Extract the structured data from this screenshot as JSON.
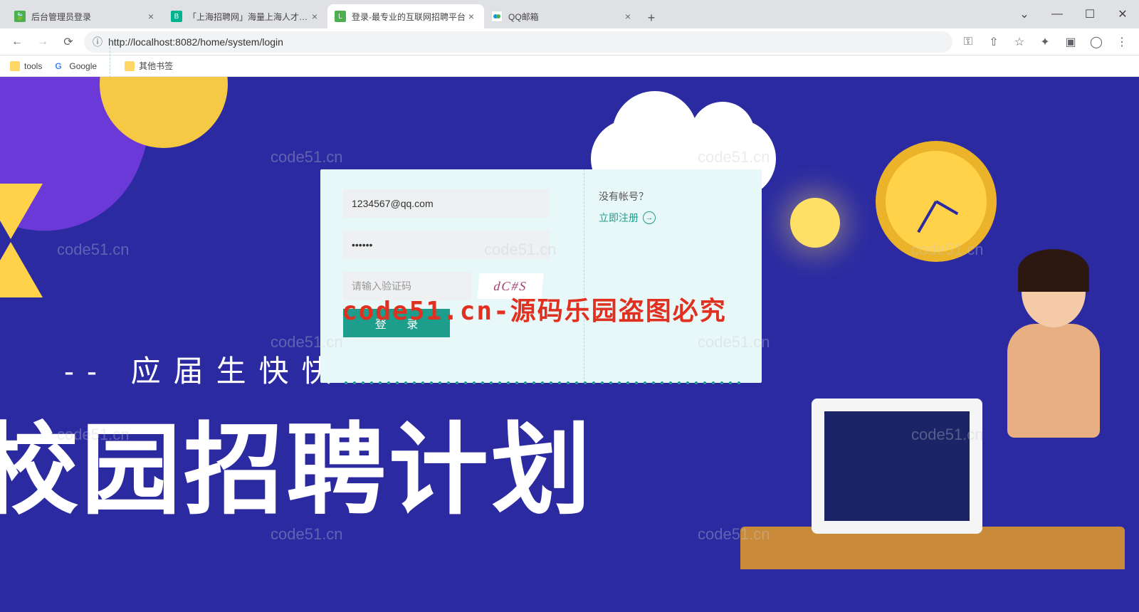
{
  "browser": {
    "tabs": [
      {
        "title": "后台管理员登录",
        "favicon_bg": "#4caf50"
      },
      {
        "title": "「上海招聘网」海量上海人才招聘",
        "favicon_bg": "#00b38f",
        "favicon_text": "B"
      },
      {
        "title": "登录-最专业的互联网招聘平台",
        "favicon_bg": "#4caf50",
        "favicon_text": "L",
        "active": true
      },
      {
        "title": "QQ邮箱",
        "favicon_bg": "#ffffff"
      }
    ],
    "new_tab": "+",
    "win": {
      "min": "—",
      "max": "☐",
      "close": "✕",
      "drop": "⌄"
    },
    "nav": {
      "back": "←",
      "fwd": "→",
      "reload": "⟳"
    },
    "url_info_icon": "ⓘ",
    "url": "http://localhost:8082/home/system/login",
    "ext": {
      "key": "⚿",
      "share": "⇧",
      "star": "☆",
      "puzzle": "✦",
      "box": "▣",
      "user": "◯",
      "menu": "⋮"
    },
    "bookmarks": {
      "tools": "tools",
      "google": "Google",
      "other": "其他书签"
    }
  },
  "page": {
    "slogan_prefix": "--",
    "slogan_small": "应届生快快",
    "slogan_big": "校园招聘计划"
  },
  "login": {
    "username_value": "1234567@qq.com",
    "password_value": "••••••",
    "captcha_placeholder": "请输入验证码",
    "captcha_text": "dC#S",
    "login_btn": "登 录",
    "no_account_q": "没有帐号？",
    "register": "立即注册",
    "register_arrow": "→"
  },
  "watermark": {
    "text": "code51.cn",
    "red": "code51.cn-源码乐园盗图必究"
  }
}
